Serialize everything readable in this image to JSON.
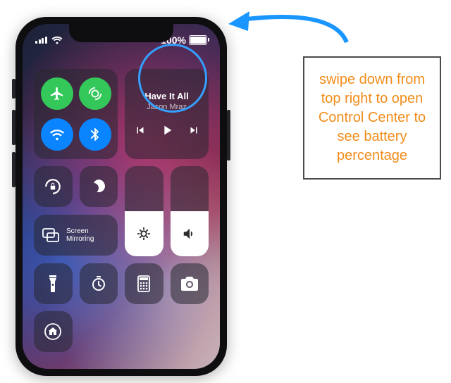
{
  "status": {
    "battery_percent": "100%"
  },
  "music": {
    "title": "Have It All",
    "artist": "Jason Mraz"
  },
  "screen_mirroring": {
    "label_line1": "Screen",
    "label_line2": "Mirroring"
  },
  "callout": {
    "text": "swipe down from top right to open Control Center to see battery percentage"
  }
}
